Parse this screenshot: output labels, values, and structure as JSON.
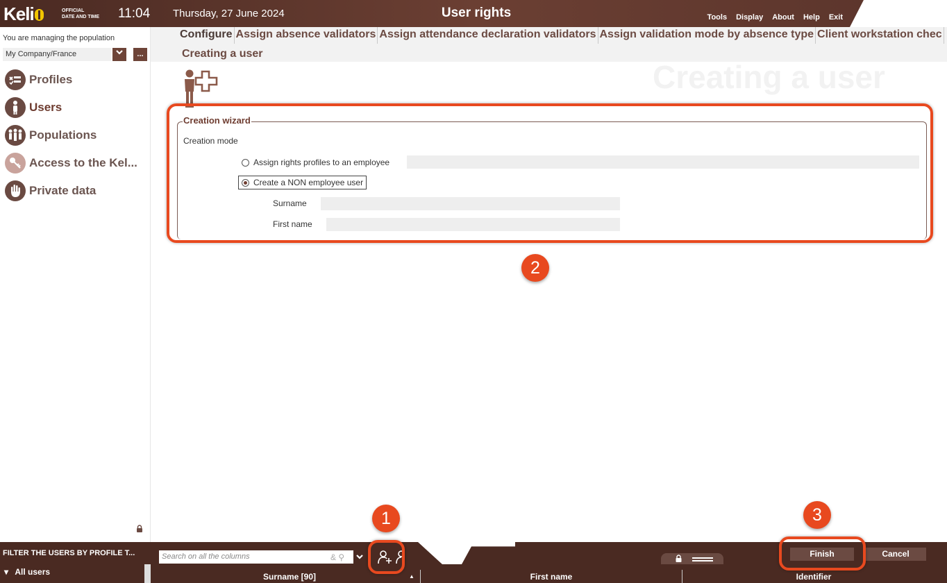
{
  "header": {
    "logo_text": "Keli",
    "official_line1": "OFFICIAL",
    "official_line2": "DATE AND TIME",
    "time": "11:04",
    "date": "Thursday, 27 June 2024",
    "title": "User rights",
    "menu": [
      "Tools",
      "Display",
      "About",
      "Help",
      "Exit"
    ]
  },
  "sidebar": {
    "managing_label": "You are managing the population",
    "population_value": "My Company/France",
    "more_button": "...",
    "items": [
      {
        "label": "Profiles",
        "icon": "profiles-icon"
      },
      {
        "label": "Users",
        "icon": "user-icon"
      },
      {
        "label": "Populations",
        "icon": "populations-icon"
      },
      {
        "label": "Access to the Kel...",
        "icon": "key-icon"
      },
      {
        "label": "Private data",
        "icon": "hand-icon"
      }
    ]
  },
  "tabs": [
    "Configure",
    "Assign absence validators",
    "Assign attendance declaration validators",
    "Assign validation mode by absence type",
    "Client workstation chec"
  ],
  "page": {
    "subtitle": "Creating a user",
    "watermark": "Creating a user"
  },
  "wizard": {
    "legend": "Creation wizard",
    "creation_mode_label": "Creation mode",
    "option_employee": "Assign rights profiles to an employee",
    "option_non_employee": "Create a NON employee user",
    "selected_option": "non_employee",
    "surname_label": "Surname",
    "surname_value": "",
    "first_name_label": "First name",
    "first_name_value": ""
  },
  "filter": {
    "header": "FILTER THE USERS BY PROFILE T...",
    "tree_root": "All users"
  },
  "search": {
    "placeholder": "Search on all the columns"
  },
  "grid": {
    "columns": [
      "Surname [90]",
      "First name",
      "Identifier"
    ]
  },
  "actions": {
    "finish": "Finish",
    "cancel": "Cancel"
  },
  "callouts": [
    "1",
    "2",
    "3"
  ],
  "colors": {
    "brand_dark": "#4a2a22",
    "brand": "#6b4a42",
    "callout": "#e8491f",
    "logo_accent": "#f2c500"
  }
}
